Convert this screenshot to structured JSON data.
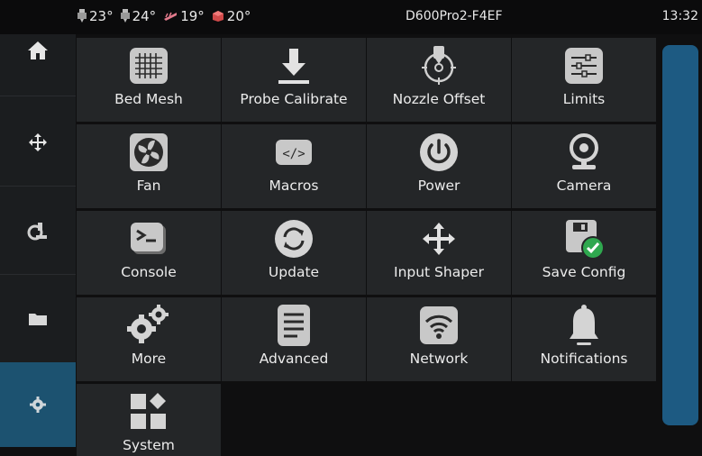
{
  "status_bar": {
    "temperatures": [
      {
        "icon": "extruder-icon",
        "value": "23°"
      },
      {
        "icon": "extruder-icon",
        "value": "24°"
      },
      {
        "icon": "heater-bed-icon",
        "value": "19°"
      },
      {
        "icon": "chamber-icon",
        "value": "20°"
      }
    ],
    "hostname": "D600Pro2-F4EF",
    "time": "13:32"
  },
  "sidebar": {
    "items": [
      {
        "icon": "home-icon",
        "active": false
      },
      {
        "icon": "move-icon",
        "active": false
      },
      {
        "icon": "extrude-icon",
        "active": false
      },
      {
        "icon": "folder-icon",
        "active": false
      },
      {
        "icon": "gear-icon",
        "active": true
      }
    ]
  },
  "menu": {
    "tiles": [
      {
        "label": "Bed Mesh",
        "icon": "bed-mesh-icon"
      },
      {
        "label": "Probe Calibrate",
        "icon": "probe-calibrate-icon"
      },
      {
        "label": "Nozzle Offset",
        "icon": "nozzle-offset-icon"
      },
      {
        "label": "Limits",
        "icon": "limits-icon"
      },
      {
        "label": "Fan",
        "icon": "fan-icon"
      },
      {
        "label": "Macros",
        "icon": "macros-icon"
      },
      {
        "label": "Power",
        "icon": "power-icon"
      },
      {
        "label": "Camera",
        "icon": "camera-icon"
      },
      {
        "label": "Console",
        "icon": "console-icon"
      },
      {
        "label": "Update",
        "icon": "update-icon"
      },
      {
        "label": "Input Shaper",
        "icon": "input-shaper-icon"
      },
      {
        "label": "Save Config",
        "icon": "save-config-icon"
      },
      {
        "label": "More",
        "icon": "more-icon"
      },
      {
        "label": "Advanced",
        "icon": "advanced-icon"
      },
      {
        "label": "Network",
        "icon": "network-icon"
      },
      {
        "label": "Notifications",
        "icon": "bell-icon"
      },
      {
        "label": "System",
        "icon": "system-icon"
      }
    ]
  },
  "colors": {
    "accent": "#1c5270",
    "tile": "#242628",
    "background": "#0f0f10"
  }
}
